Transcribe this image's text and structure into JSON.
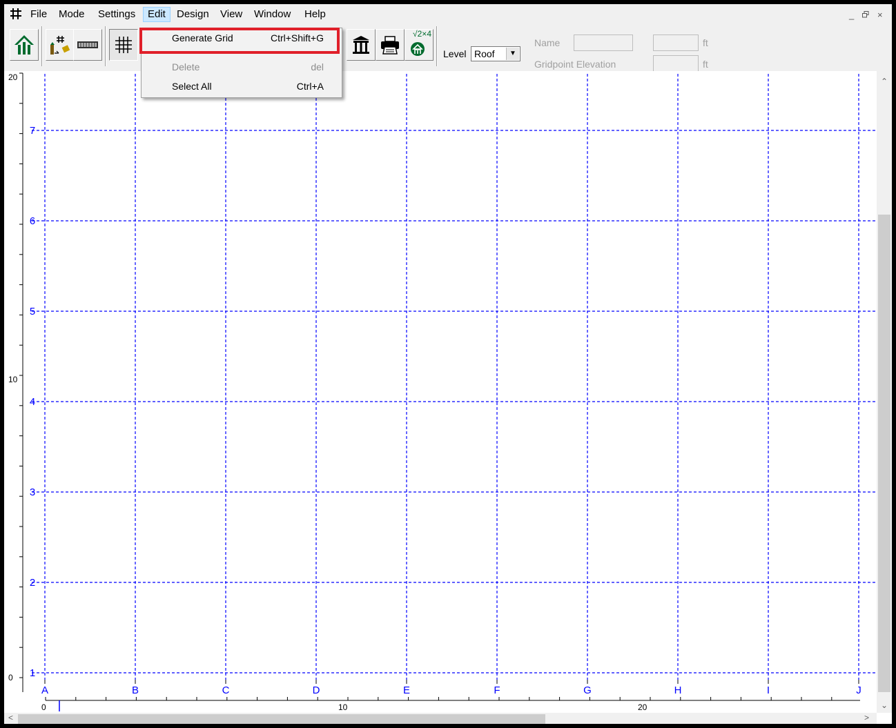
{
  "menubar": {
    "items": [
      "File",
      "Mode",
      "Settings",
      "Edit",
      "Design",
      "View",
      "Window",
      "Help"
    ],
    "active": "Edit",
    "window_controls": [
      "_",
      "̈",
      "×"
    ]
  },
  "toolbar": {
    "buttons": [
      "home-icon",
      "grid-import-icon",
      "beam-icon",
      "grid-icon",
      "column-icon",
      "print-icon",
      "check-2x4-icon"
    ],
    "check_badge": "√2×4",
    "level_label": "Level",
    "level_value": "Roof",
    "name_label": "Name",
    "name_value": "",
    "name_unit": "ft",
    "gridpoint_label": "Gridpoint Elevation",
    "gridpoint_value": "",
    "gridpoint_unit": "ft"
  },
  "edit_menu": {
    "items": [
      {
        "label": "Generate Grid",
        "shortcut": "Ctrl+Shift+G",
        "enabled": true,
        "highlighted": true
      },
      {
        "label": "Delete",
        "shortcut": "del",
        "enabled": false
      },
      {
        "label": "Select All",
        "shortcut": "Ctrl+A",
        "enabled": true
      }
    ]
  },
  "grid": {
    "columns": [
      "A",
      "B",
      "C",
      "D",
      "E",
      "F",
      "G",
      "H",
      "I",
      "J"
    ],
    "rows": [
      "7",
      "6",
      "5",
      "4",
      "3",
      "2",
      "1"
    ],
    "ruler_left": [
      "20",
      "10",
      "0"
    ],
    "ruler_bottom": [
      "0",
      "10",
      "20"
    ],
    "line_color": "#0000ff"
  }
}
